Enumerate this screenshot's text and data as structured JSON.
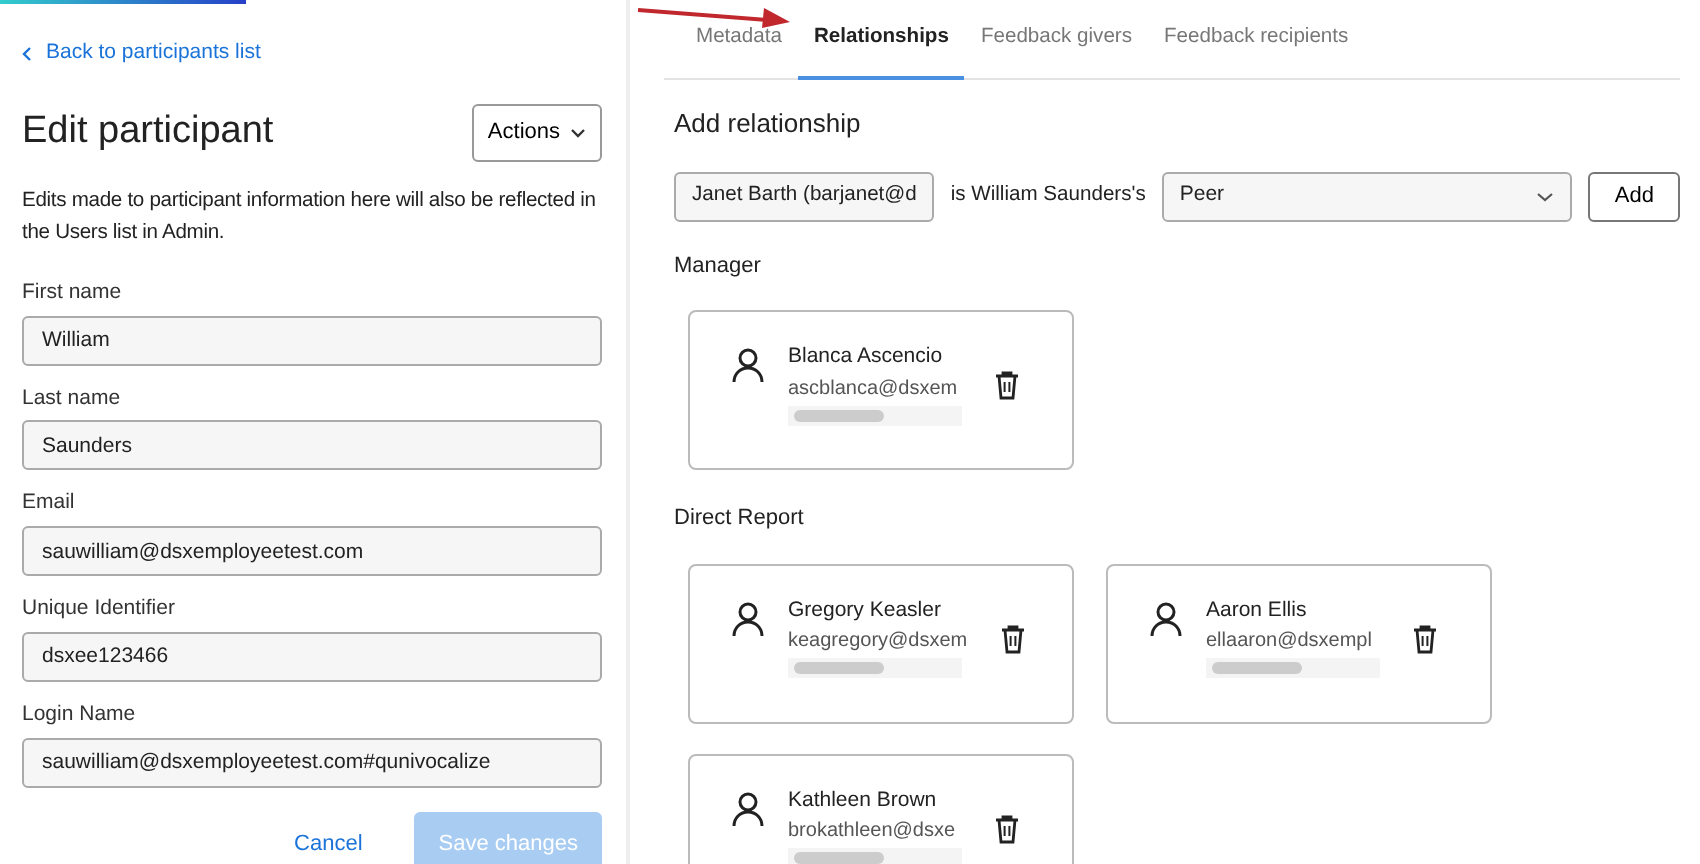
{
  "loading_bar": {
    "level": 0.145
  },
  "back_link": "Back to participants list",
  "title": "Edit participant",
  "actions_button": "Actions",
  "description": "Edits made to participant information here will also be reflected in the Users list in Admin.",
  "fields": [
    {
      "label": "First name",
      "value": "William"
    },
    {
      "label": "Last name",
      "value": "Saunders"
    },
    {
      "label": "Email",
      "value": "sauwilliam@dsxemployeetest.com"
    },
    {
      "label": "Unique Identifier",
      "value": "dsxee123466"
    },
    {
      "label": "Login Name",
      "value": "sauwilliam@dsxemployeetest.com#qunivocalize"
    }
  ],
  "buttons": [
    {
      "label": "Cancel",
      "kind": "link",
      "disabled": false
    },
    {
      "label": "Save changes",
      "kind": "primary",
      "disabled": true
    }
  ],
  "tabs": [
    {
      "label": "Metadata",
      "selected": false
    },
    {
      "label": "Relationships",
      "selected": true
    },
    {
      "label": "Feedback givers",
      "selected": false
    },
    {
      "label": "Feedback recipients",
      "selected": false
    }
  ],
  "add_relationship": {
    "title": "Add relationship",
    "person_value": "Janet Barth (barjanet@d",
    "connector_text": "is William Saunders's",
    "relationship_value": "Peer",
    "add_button": "Add"
  },
  "groups": [
    {
      "title": "Manager",
      "people": [
        {
          "name": "Blanca Ascencio",
          "email": "ascblanca@dsxem"
        }
      ]
    },
    {
      "title": "Direct Report",
      "people": [
        {
          "name": "Gregory Keasler",
          "email": "keagregory@dsxem"
        },
        {
          "name": "Aaron Ellis",
          "email": "ellaaron@dsxempl"
        },
        {
          "name": "Kathleen Brown",
          "email": "brokathleen@dsxe"
        }
      ]
    }
  ]
}
